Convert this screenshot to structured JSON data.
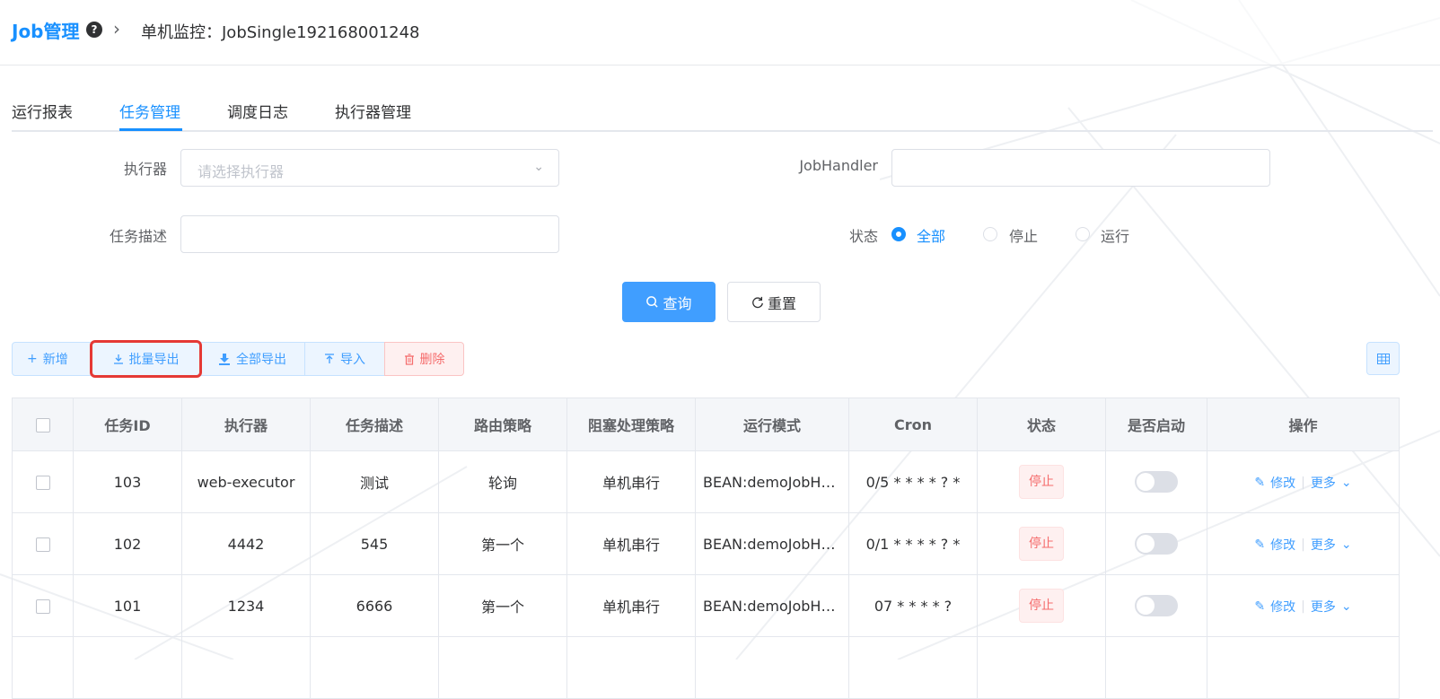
{
  "header": {
    "brand": "Job管理",
    "help_icon": "question-circle-icon",
    "separator_icon": "chevron-right-icon",
    "breadcrumb": "单机监控：JobSingle192168001248"
  },
  "tabs": [
    {
      "label": "运行报表",
      "active": false
    },
    {
      "label": "任务管理",
      "active": true
    },
    {
      "label": "调度日志",
      "active": false
    },
    {
      "label": "执行器管理",
      "active": false
    }
  ],
  "filters": {
    "executor_label": "执行器",
    "executor_placeholder": "请选择执行器",
    "jobhandler_label": "JobHandler",
    "jobhandler_value": "",
    "desc_label": "任务描述",
    "desc_value": "",
    "status_label": "状态",
    "status_options": [
      {
        "label": "全部",
        "checked": true
      },
      {
        "label": "停止",
        "checked": false
      },
      {
        "label": "运行",
        "checked": false
      }
    ],
    "search_button": "查询",
    "reset_button": "重置"
  },
  "toolbar": {
    "add": "新增",
    "batch_export": "批量导出",
    "export_all": "全部导出",
    "import": "导入",
    "delete": "删除",
    "column_settings_icon": "table-grid-icon"
  },
  "table": {
    "columns": [
      "任务ID",
      "执行器",
      "任务描述",
      "路由策略",
      "阻塞处理策略",
      "运行模式",
      "Cron",
      "状态",
      "是否启动",
      "操作"
    ],
    "rows": [
      {
        "id": "103",
        "executor": "web-executor",
        "desc": "测试",
        "route": "轮询",
        "block": "单机串行",
        "mode": "BEAN:demoJobHandler",
        "cron": "0/5 * * * * ? *",
        "status": "停止",
        "enabled": false,
        "edit": "修改",
        "more": "更多"
      },
      {
        "id": "102",
        "executor": "4442",
        "desc": "545",
        "route": "第一个",
        "block": "单机串行",
        "mode": "BEAN:demoJobHandler",
        "cron": "0/1 * * * * ? *",
        "status": "停止",
        "enabled": false,
        "edit": "修改",
        "more": "更多"
      },
      {
        "id": "101",
        "executor": "1234",
        "desc": "6666",
        "route": "第一个",
        "block": "单机串行",
        "mode": "BEAN:demoJobHandler",
        "cron": "07 * * * * ?",
        "status": "停止",
        "enabled": false,
        "edit": "修改",
        "more": "更多"
      }
    ]
  },
  "colors": {
    "primary": "#409eff",
    "brand": "#1890ff",
    "danger": "#f56c6c",
    "highlight_box": "#e53935"
  }
}
